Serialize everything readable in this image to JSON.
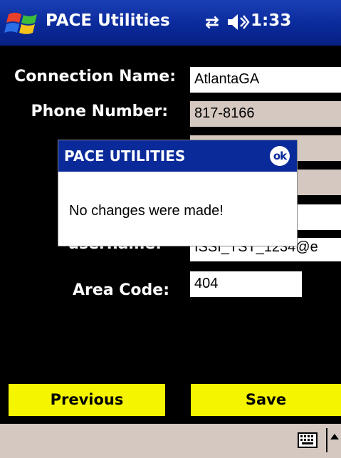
{
  "titlebar": {
    "app_title": "PACE Utilities",
    "clock": "1:33",
    "start_icon": "windows-flag-icon",
    "connectivity_icon": "connectivity-icon",
    "speaker_icon": "speaker-icon",
    "bg_color": "#0a2a9a"
  },
  "form": {
    "fields": [
      {
        "label": "Connection Name:",
        "value": "AtlantaGA",
        "editable": true
      },
      {
        "label": "Phone Number:",
        "value": "817-8166",
        "editable": false
      },
      {
        "label": "",
        "value": "",
        "editable": false
      },
      {
        "label": "",
        "value": "",
        "editable": false
      },
      {
        "label": "",
        "value": "",
        "editable": true
      },
      {
        "label": "username:",
        "value": "ISSI_TST_1234@e",
        "editable": true
      },
      {
        "label": "Area Code:",
        "value": "404",
        "editable": true
      }
    ]
  },
  "dialog": {
    "title": "PACE UTILITIES",
    "ok_label": "ok",
    "message": "No changes were made!"
  },
  "buttons": {
    "previous_label": "Previous",
    "save_label": "Save",
    "color": "#f5f500"
  },
  "bottombar": {
    "keyboard_icon": "keyboard-icon",
    "arrow_icon": "input-menu-arrow-icon"
  }
}
